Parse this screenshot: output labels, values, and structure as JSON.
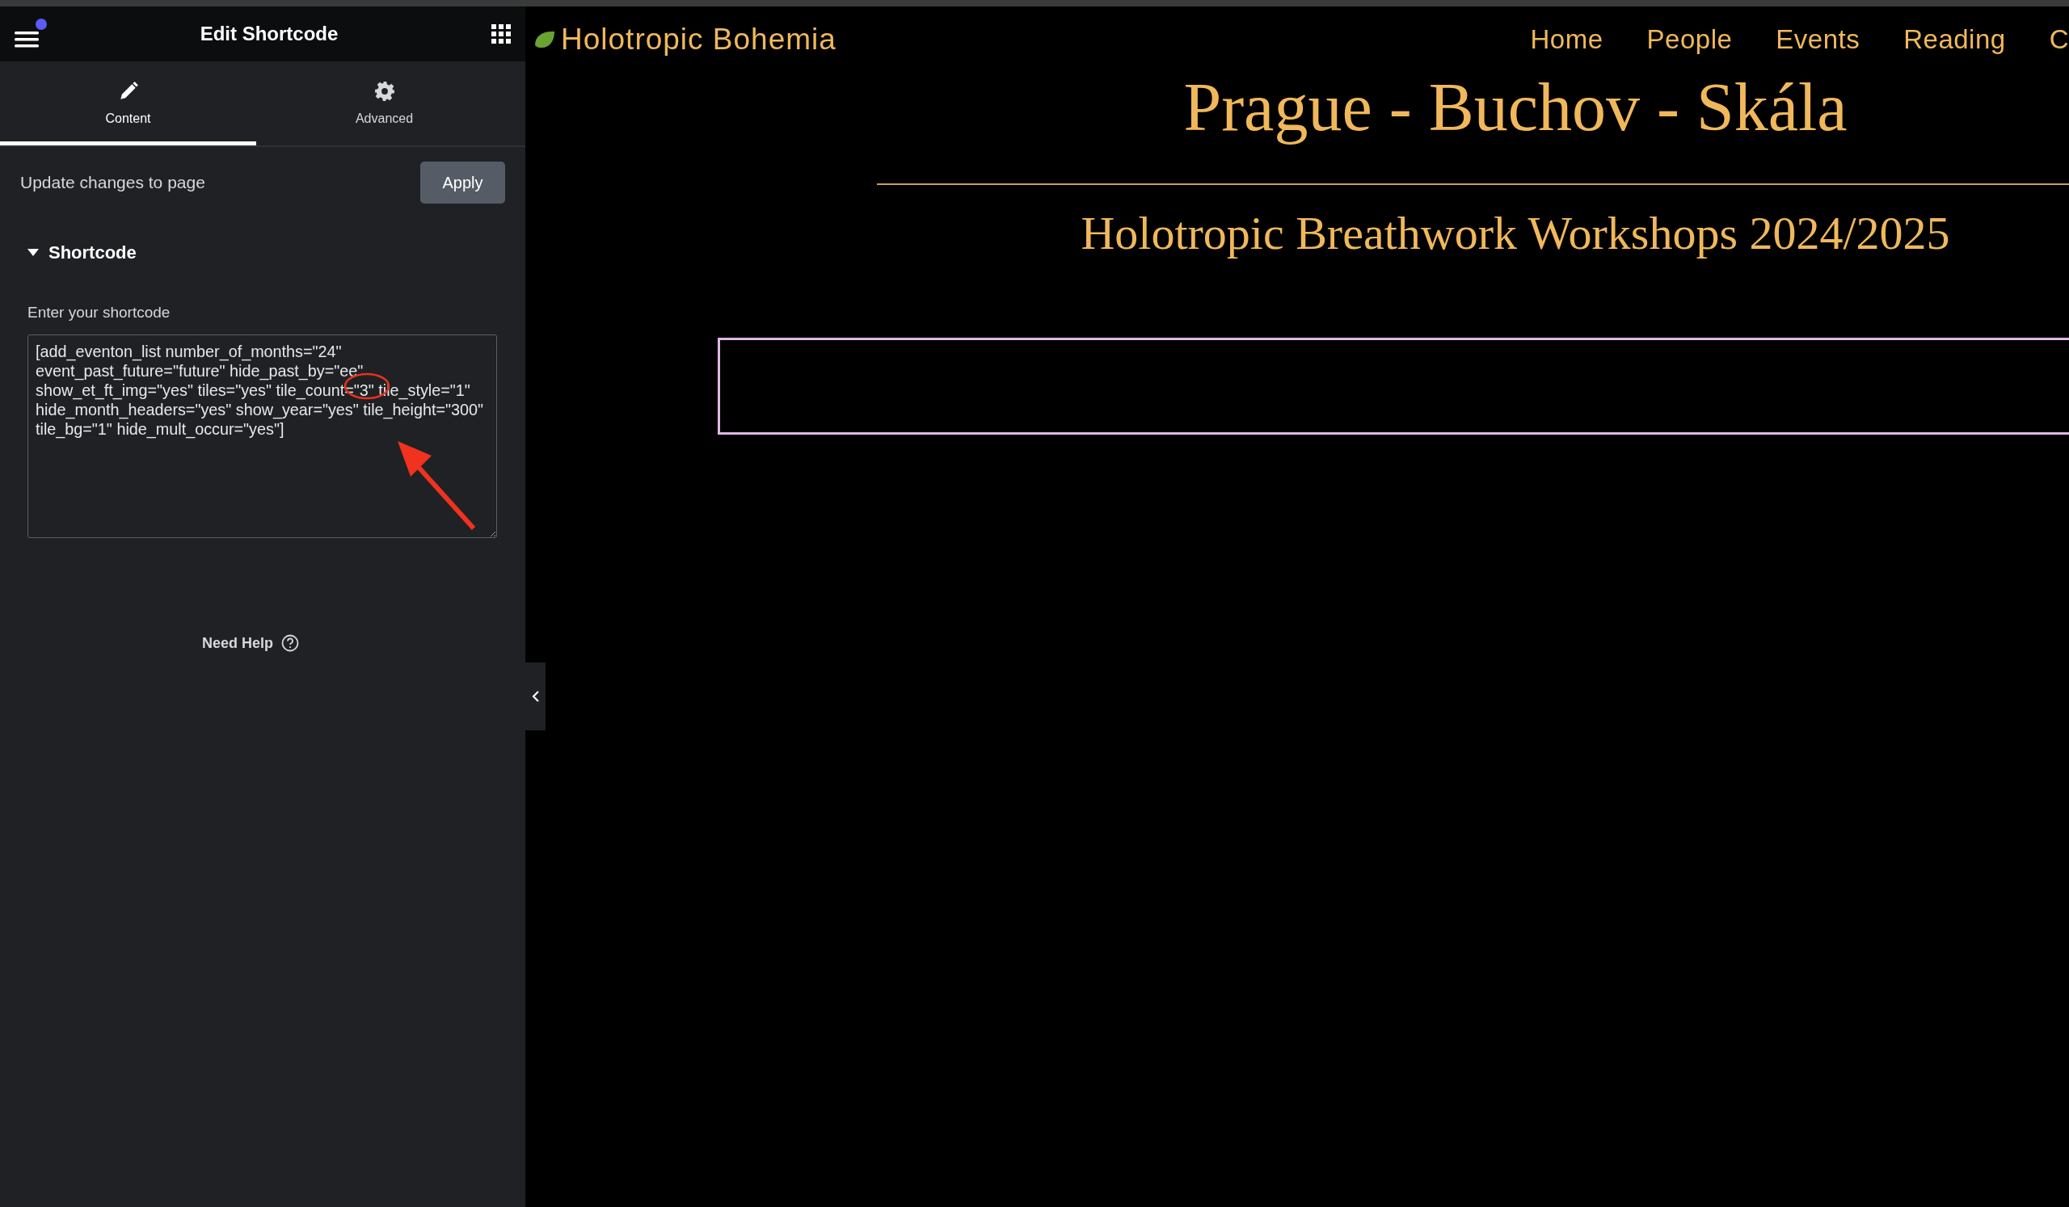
{
  "editor": {
    "title": "Edit Shortcode",
    "has_notification": true,
    "tabs": [
      {
        "label": "Content",
        "selected": true
      },
      {
        "label": "Advanced",
        "selected": false
      }
    ],
    "update_label": "Update changes to page",
    "apply_button": "Apply",
    "section": {
      "title": "Shortcode",
      "expanded": true
    },
    "field_label": "Enter your shortcode",
    "shortcode": "[add_eventon_list number_of_months=\"24\" event_past_future=\"future\" hide_past_by=\"ee\" show_et_ft_img=\"yes\" tiles=\"yes\" tile_count=\"3\" tile_style=\"1\" hide_month_headers=\"yes\" show_year=\"yes\" tile_height=\"300\" tile_bg=\"1\" hide_mult_occur=\"yes\"]",
    "help": "Need Help"
  },
  "site": {
    "brand": "Holotropic Bohemia",
    "nav": [
      "Home",
      "People",
      "Events",
      "Reading",
      "C"
    ],
    "title": "Prague - Buchov - Skála",
    "subtitle": "Holotropic Breathwork Workshops 2024/2025"
  }
}
